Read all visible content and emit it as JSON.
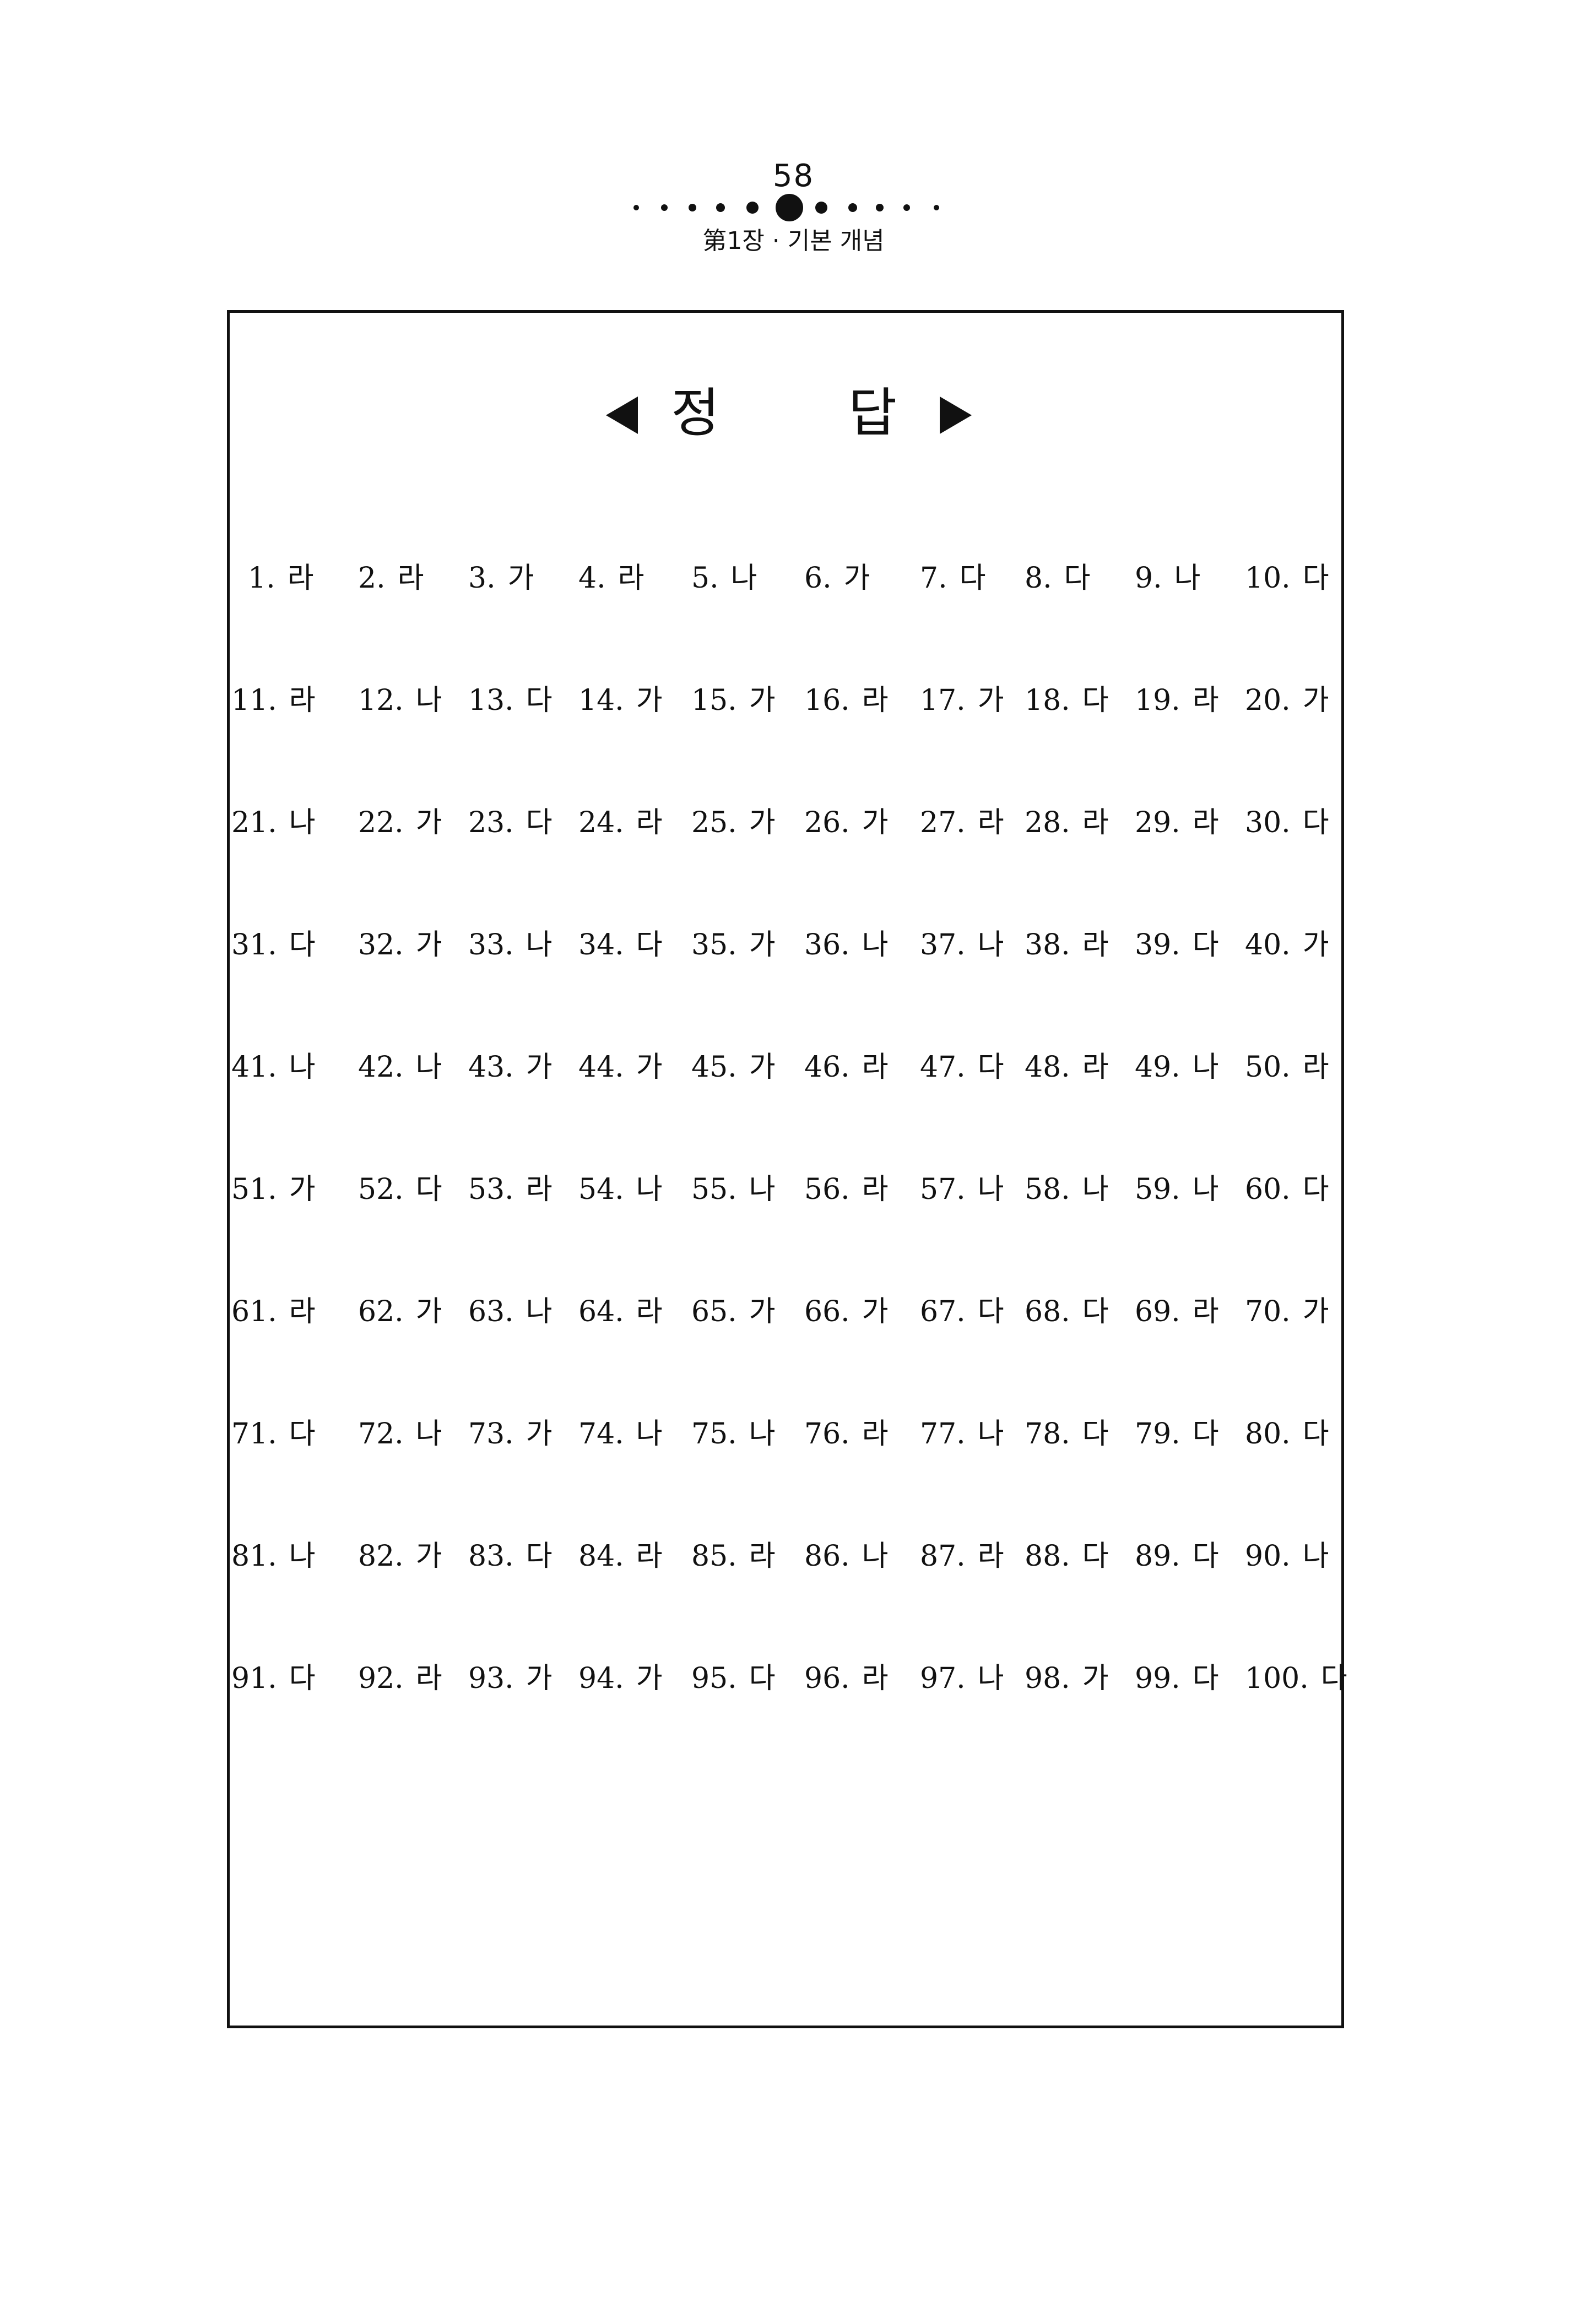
{
  "header": {
    "page_number": "58",
    "chapter_title": "第1장 · 기본 개념"
  },
  "box": {
    "title_first": "정",
    "title_second": "답",
    "left_arrow_icon": "left-triangle-icon",
    "right_arrow_icon": "right-triangle-icon"
  },
  "answers": [
    [
      {
        "n": "1.",
        "a": "라"
      },
      {
        "n": "2.",
        "a": "라"
      },
      {
        "n": "3.",
        "a": "가"
      },
      {
        "n": "4.",
        "a": "라"
      },
      {
        "n": "5.",
        "a": "나"
      },
      {
        "n": "6.",
        "a": "가"
      },
      {
        "n": "7.",
        "a": "다"
      },
      {
        "n": "8.",
        "a": "다"
      },
      {
        "n": "9.",
        "a": "나"
      },
      {
        "n": "10.",
        "a": "다"
      }
    ],
    [
      {
        "n": "11.",
        "a": "라"
      },
      {
        "n": "12.",
        "a": "나"
      },
      {
        "n": "13.",
        "a": "다"
      },
      {
        "n": "14.",
        "a": "가"
      },
      {
        "n": "15.",
        "a": "가"
      },
      {
        "n": "16.",
        "a": "라"
      },
      {
        "n": "17.",
        "a": "가"
      },
      {
        "n": "18.",
        "a": "다"
      },
      {
        "n": "19.",
        "a": "라"
      },
      {
        "n": "20.",
        "a": "가"
      }
    ],
    [
      {
        "n": "21.",
        "a": "나"
      },
      {
        "n": "22.",
        "a": "가"
      },
      {
        "n": "23.",
        "a": "다"
      },
      {
        "n": "24.",
        "a": "라"
      },
      {
        "n": "25.",
        "a": "가"
      },
      {
        "n": "26.",
        "a": "가"
      },
      {
        "n": "27.",
        "a": "라"
      },
      {
        "n": "28.",
        "a": "라"
      },
      {
        "n": "29.",
        "a": "라"
      },
      {
        "n": "30.",
        "a": "다"
      }
    ],
    [
      {
        "n": "31.",
        "a": "다"
      },
      {
        "n": "32.",
        "a": "가"
      },
      {
        "n": "33.",
        "a": "나"
      },
      {
        "n": "34.",
        "a": "다"
      },
      {
        "n": "35.",
        "a": "가"
      },
      {
        "n": "36.",
        "a": "나"
      },
      {
        "n": "37.",
        "a": "나"
      },
      {
        "n": "38.",
        "a": "라"
      },
      {
        "n": "39.",
        "a": "다"
      },
      {
        "n": "40.",
        "a": "가"
      }
    ],
    [
      {
        "n": "41.",
        "a": "나"
      },
      {
        "n": "42.",
        "a": "나"
      },
      {
        "n": "43.",
        "a": "가"
      },
      {
        "n": "44.",
        "a": "가"
      },
      {
        "n": "45.",
        "a": "가"
      },
      {
        "n": "46.",
        "a": "라"
      },
      {
        "n": "47.",
        "a": "다"
      },
      {
        "n": "48.",
        "a": "라"
      },
      {
        "n": "49.",
        "a": "나"
      },
      {
        "n": "50.",
        "a": "라"
      }
    ],
    [
      {
        "n": "51.",
        "a": "가"
      },
      {
        "n": "52.",
        "a": "다"
      },
      {
        "n": "53.",
        "a": "라"
      },
      {
        "n": "54.",
        "a": "나"
      },
      {
        "n": "55.",
        "a": "나"
      },
      {
        "n": "56.",
        "a": "라"
      },
      {
        "n": "57.",
        "a": "나"
      },
      {
        "n": "58.",
        "a": "나"
      },
      {
        "n": "59.",
        "a": "나"
      },
      {
        "n": "60.",
        "a": "다"
      }
    ],
    [
      {
        "n": "61.",
        "a": "라"
      },
      {
        "n": "62.",
        "a": "가"
      },
      {
        "n": "63.",
        "a": "나"
      },
      {
        "n": "64.",
        "a": "라"
      },
      {
        "n": "65.",
        "a": "가"
      },
      {
        "n": "66.",
        "a": "가"
      },
      {
        "n": "67.",
        "a": "다"
      },
      {
        "n": "68.",
        "a": "다"
      },
      {
        "n": "69.",
        "a": "라"
      },
      {
        "n": "70.",
        "a": "가"
      }
    ],
    [
      {
        "n": "71.",
        "a": "다"
      },
      {
        "n": "72.",
        "a": "나"
      },
      {
        "n": "73.",
        "a": "가"
      },
      {
        "n": "74.",
        "a": "나"
      },
      {
        "n": "75.",
        "a": "나"
      },
      {
        "n": "76.",
        "a": "라"
      },
      {
        "n": "77.",
        "a": "나"
      },
      {
        "n": "78.",
        "a": "다"
      },
      {
        "n": "79.",
        "a": "다"
      },
      {
        "n": "80.",
        "a": "다"
      }
    ],
    [
      {
        "n": "81.",
        "a": "나"
      },
      {
        "n": "82.",
        "a": "가"
      },
      {
        "n": "83.",
        "a": "다"
      },
      {
        "n": "84.",
        "a": "라"
      },
      {
        "n": "85.",
        "a": "라"
      },
      {
        "n": "86.",
        "a": "나"
      },
      {
        "n": "87.",
        "a": "라"
      },
      {
        "n": "88.",
        "a": "다"
      },
      {
        "n": "89.",
        "a": "다"
      },
      {
        "n": "90.",
        "a": "나"
      }
    ],
    [
      {
        "n": "91.",
        "a": "다"
      },
      {
        "n": "92.",
        "a": "라"
      },
      {
        "n": "93.",
        "a": "가"
      },
      {
        "n": "94.",
        "a": "가"
      },
      {
        "n": "95.",
        "a": "다"
      },
      {
        "n": "96.",
        "a": "라"
      },
      {
        "n": "97.",
        "a": "나"
      },
      {
        "n": "98.",
        "a": "가"
      },
      {
        "n": "99.",
        "a": "다"
      },
      {
        "n": "100.",
        "a": "다"
      }
    ]
  ]
}
